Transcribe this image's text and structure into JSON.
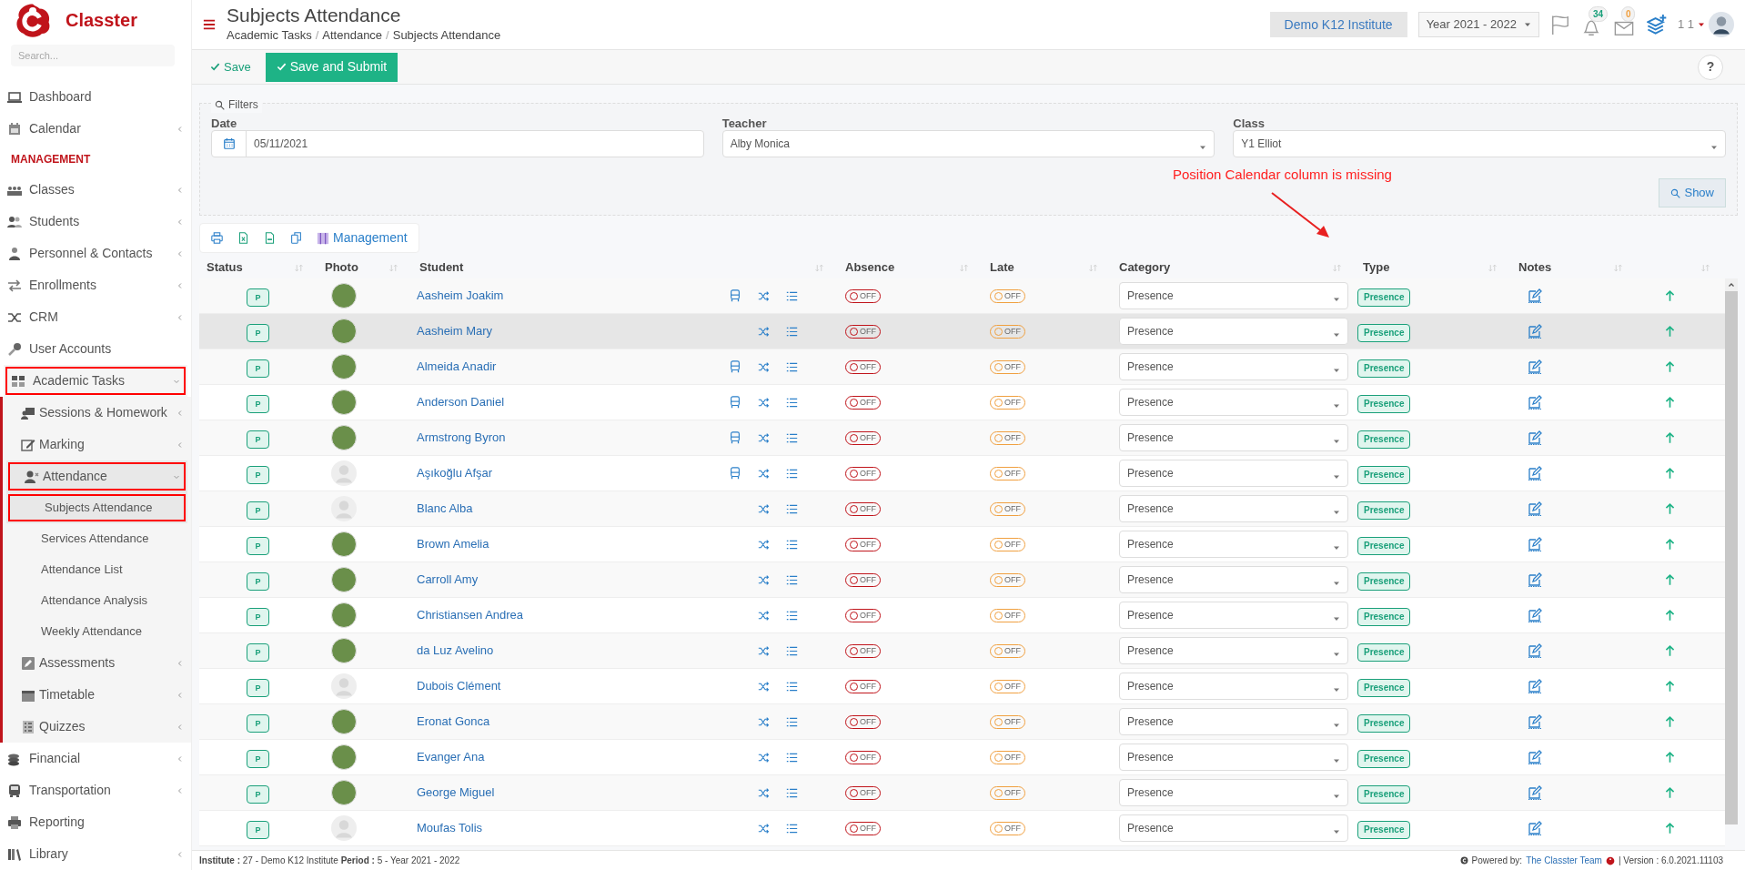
{
  "brand": {
    "name": "Classter"
  },
  "sidebar": {
    "search_placeholder": "Search...",
    "items": [
      {
        "label": "Dashboard",
        "kind": "item"
      },
      {
        "label": "Calendar",
        "kind": "item",
        "expanded": false
      },
      {
        "label": "MANAGEMENT",
        "kind": "section"
      },
      {
        "label": "Classes",
        "kind": "item",
        "expanded": false
      },
      {
        "label": "Students",
        "kind": "item",
        "expanded": false
      },
      {
        "label": "Personnel & Contacts",
        "kind": "item",
        "expanded": false
      },
      {
        "label": "Enrollments",
        "kind": "item",
        "expanded": false
      },
      {
        "label": "CRM",
        "kind": "item",
        "expanded": false
      },
      {
        "label": "User Accounts",
        "kind": "item"
      },
      {
        "label": "Academic Tasks",
        "kind": "item",
        "expanded": true,
        "highlighted": true,
        "children": [
          {
            "label": "Sessions & Homework",
            "expanded": false,
            "highlighted": false
          },
          {
            "label": "Marking",
            "expanded": false,
            "highlighted": false
          },
          {
            "label": "Attendance",
            "expanded": true,
            "highlighted": true,
            "children": [
              {
                "label": "Subjects Attendance",
                "selected": true,
                "highlighted": true
              },
              {
                "label": "Services Attendance",
                "selected": false,
                "highlighted": false
              },
              {
                "label": "Attendance List",
                "selected": false,
                "highlighted": false
              },
              {
                "label": "Attendance Analysis",
                "selected": false,
                "highlighted": false
              },
              {
                "label": "Weekly Attendance",
                "selected": false,
                "highlighted": false
              }
            ]
          },
          {
            "label": "Assessments",
            "expanded": false,
            "highlighted": false
          },
          {
            "label": "Timetable",
            "expanded": false,
            "highlighted": false
          },
          {
            "label": "Quizzes",
            "expanded": false,
            "highlighted": false
          }
        ]
      },
      {
        "label": "Financial",
        "kind": "item",
        "expanded": false
      },
      {
        "label": "Transportation",
        "kind": "item",
        "expanded": false
      },
      {
        "label": "Reporting",
        "kind": "item"
      },
      {
        "label": "Library",
        "kind": "item",
        "expanded": false
      }
    ]
  },
  "header": {
    "title": "Subjects Attendance",
    "breadcrumbs": [
      "Academic Tasks",
      "Attendance",
      "Subjects Attendance"
    ],
    "breadcrumb_separators": [
      "/",
      "/"
    ],
    "institute": "Demo K12 Institute",
    "year": "Year 2021 - 2022",
    "notifications": "34",
    "messages": "0",
    "user": "1 1"
  },
  "toolbar": {
    "save": "Save",
    "save_submit": "Save and Submit",
    "help": "?"
  },
  "filters": {
    "legend": "Filters",
    "date_label": "Date",
    "date": "05/11/2021",
    "teacher_label": "Teacher",
    "teacher": "Alby Monica",
    "class_label": "Class",
    "class": "Y1 Elliot",
    "show": "Show"
  },
  "annotation": {
    "text": "Position Calendar column is missing"
  },
  "table_tools": {
    "management": "Management"
  },
  "table": {
    "columns": [
      "Status",
      "Photo",
      "Student",
      "Absence",
      "Late",
      "Category",
      "Type",
      "Notes"
    ],
    "rows": [
      {
        "status": "P",
        "kind": "photo",
        "student": "Aasheim Joakim",
        "bus": true,
        "absence": "OFF",
        "late": "OFF",
        "category": "Presence",
        "type": "Presence",
        "selected": false
      },
      {
        "status": "P",
        "kind": "photo",
        "student": "Aasheim Mary",
        "bus": false,
        "absence": "OFF",
        "late": "OFF",
        "category": "Presence",
        "type": "Presence",
        "selected": true
      },
      {
        "status": "P",
        "kind": "photo",
        "student": "Almeida Anadir",
        "bus": true,
        "absence": "OFF",
        "late": "OFF",
        "category": "Presence",
        "type": "Presence",
        "selected": false
      },
      {
        "status": "P",
        "kind": "photo",
        "student": "Anderson Daniel",
        "bus": true,
        "absence": "OFF",
        "late": "OFF",
        "category": "Presence",
        "type": "Presence",
        "selected": false
      },
      {
        "status": "P",
        "kind": "photo",
        "student": "Armstrong Byron",
        "bus": true,
        "absence": "OFF",
        "late": "OFF",
        "category": "Presence",
        "type": "Presence",
        "selected": false
      },
      {
        "status": "P",
        "kind": "avatar",
        "student": "Aşıkoğlu Afşar",
        "bus": true,
        "absence": "OFF",
        "late": "OFF",
        "category": "Presence",
        "type": "Presence",
        "selected": false
      },
      {
        "status": "P",
        "kind": "avatar",
        "student": "Blanc Alba",
        "bus": false,
        "absence": "OFF",
        "late": "OFF",
        "category": "Presence",
        "type": "Presence",
        "selected": false
      },
      {
        "status": "P",
        "kind": "photo",
        "student": "Brown Amelia",
        "bus": false,
        "absence": "OFF",
        "late": "OFF",
        "category": "Presence",
        "type": "Presence",
        "selected": false
      },
      {
        "status": "P",
        "kind": "photo",
        "student": "Carroll Amy",
        "bus": false,
        "absence": "OFF",
        "late": "OFF",
        "category": "Presence",
        "type": "Presence",
        "selected": false
      },
      {
        "status": "P",
        "kind": "photo",
        "student": "Christiansen Andrea",
        "bus": false,
        "absence": "OFF",
        "late": "OFF",
        "category": "Presence",
        "type": "Presence",
        "selected": false
      },
      {
        "status": "P",
        "kind": "photo",
        "student": "da Luz Avelino",
        "bus": false,
        "absence": "OFF",
        "late": "OFF",
        "category": "Presence",
        "type": "Presence",
        "selected": false
      },
      {
        "status": "P",
        "kind": "avatar",
        "student": "Dubois Clément",
        "bus": false,
        "absence": "OFF",
        "late": "OFF",
        "category": "Presence",
        "type": "Presence",
        "selected": false
      },
      {
        "status": "P",
        "kind": "photo",
        "student": "Eronat Gonca",
        "bus": false,
        "absence": "OFF",
        "late": "OFF",
        "category": "Presence",
        "type": "Presence",
        "selected": false
      },
      {
        "status": "P",
        "kind": "photo",
        "student": "Evanger Ana",
        "bus": false,
        "absence": "OFF",
        "late": "OFF",
        "category": "Presence",
        "type": "Presence",
        "selected": false
      },
      {
        "status": "P",
        "kind": "photo",
        "student": "George Miguel",
        "bus": false,
        "absence": "OFF",
        "late": "OFF",
        "category": "Presence",
        "type": "Presence",
        "selected": false
      },
      {
        "status": "P",
        "kind": "avatar",
        "student": "Moufas Tolis",
        "bus": false,
        "absence": "OFF",
        "late": "OFF",
        "category": "Presence",
        "type": "Presence",
        "selected": false
      }
    ]
  },
  "footer": {
    "institute_label": "Institute :",
    "institute": "27 - Demo K12 Institute",
    "period_label": "Period :",
    "period": "5 - Year 2021 - 2022",
    "powered": "Powered by:",
    "team": "The Classter Team",
    "version": "| Version : 6.0.2021.11103"
  }
}
